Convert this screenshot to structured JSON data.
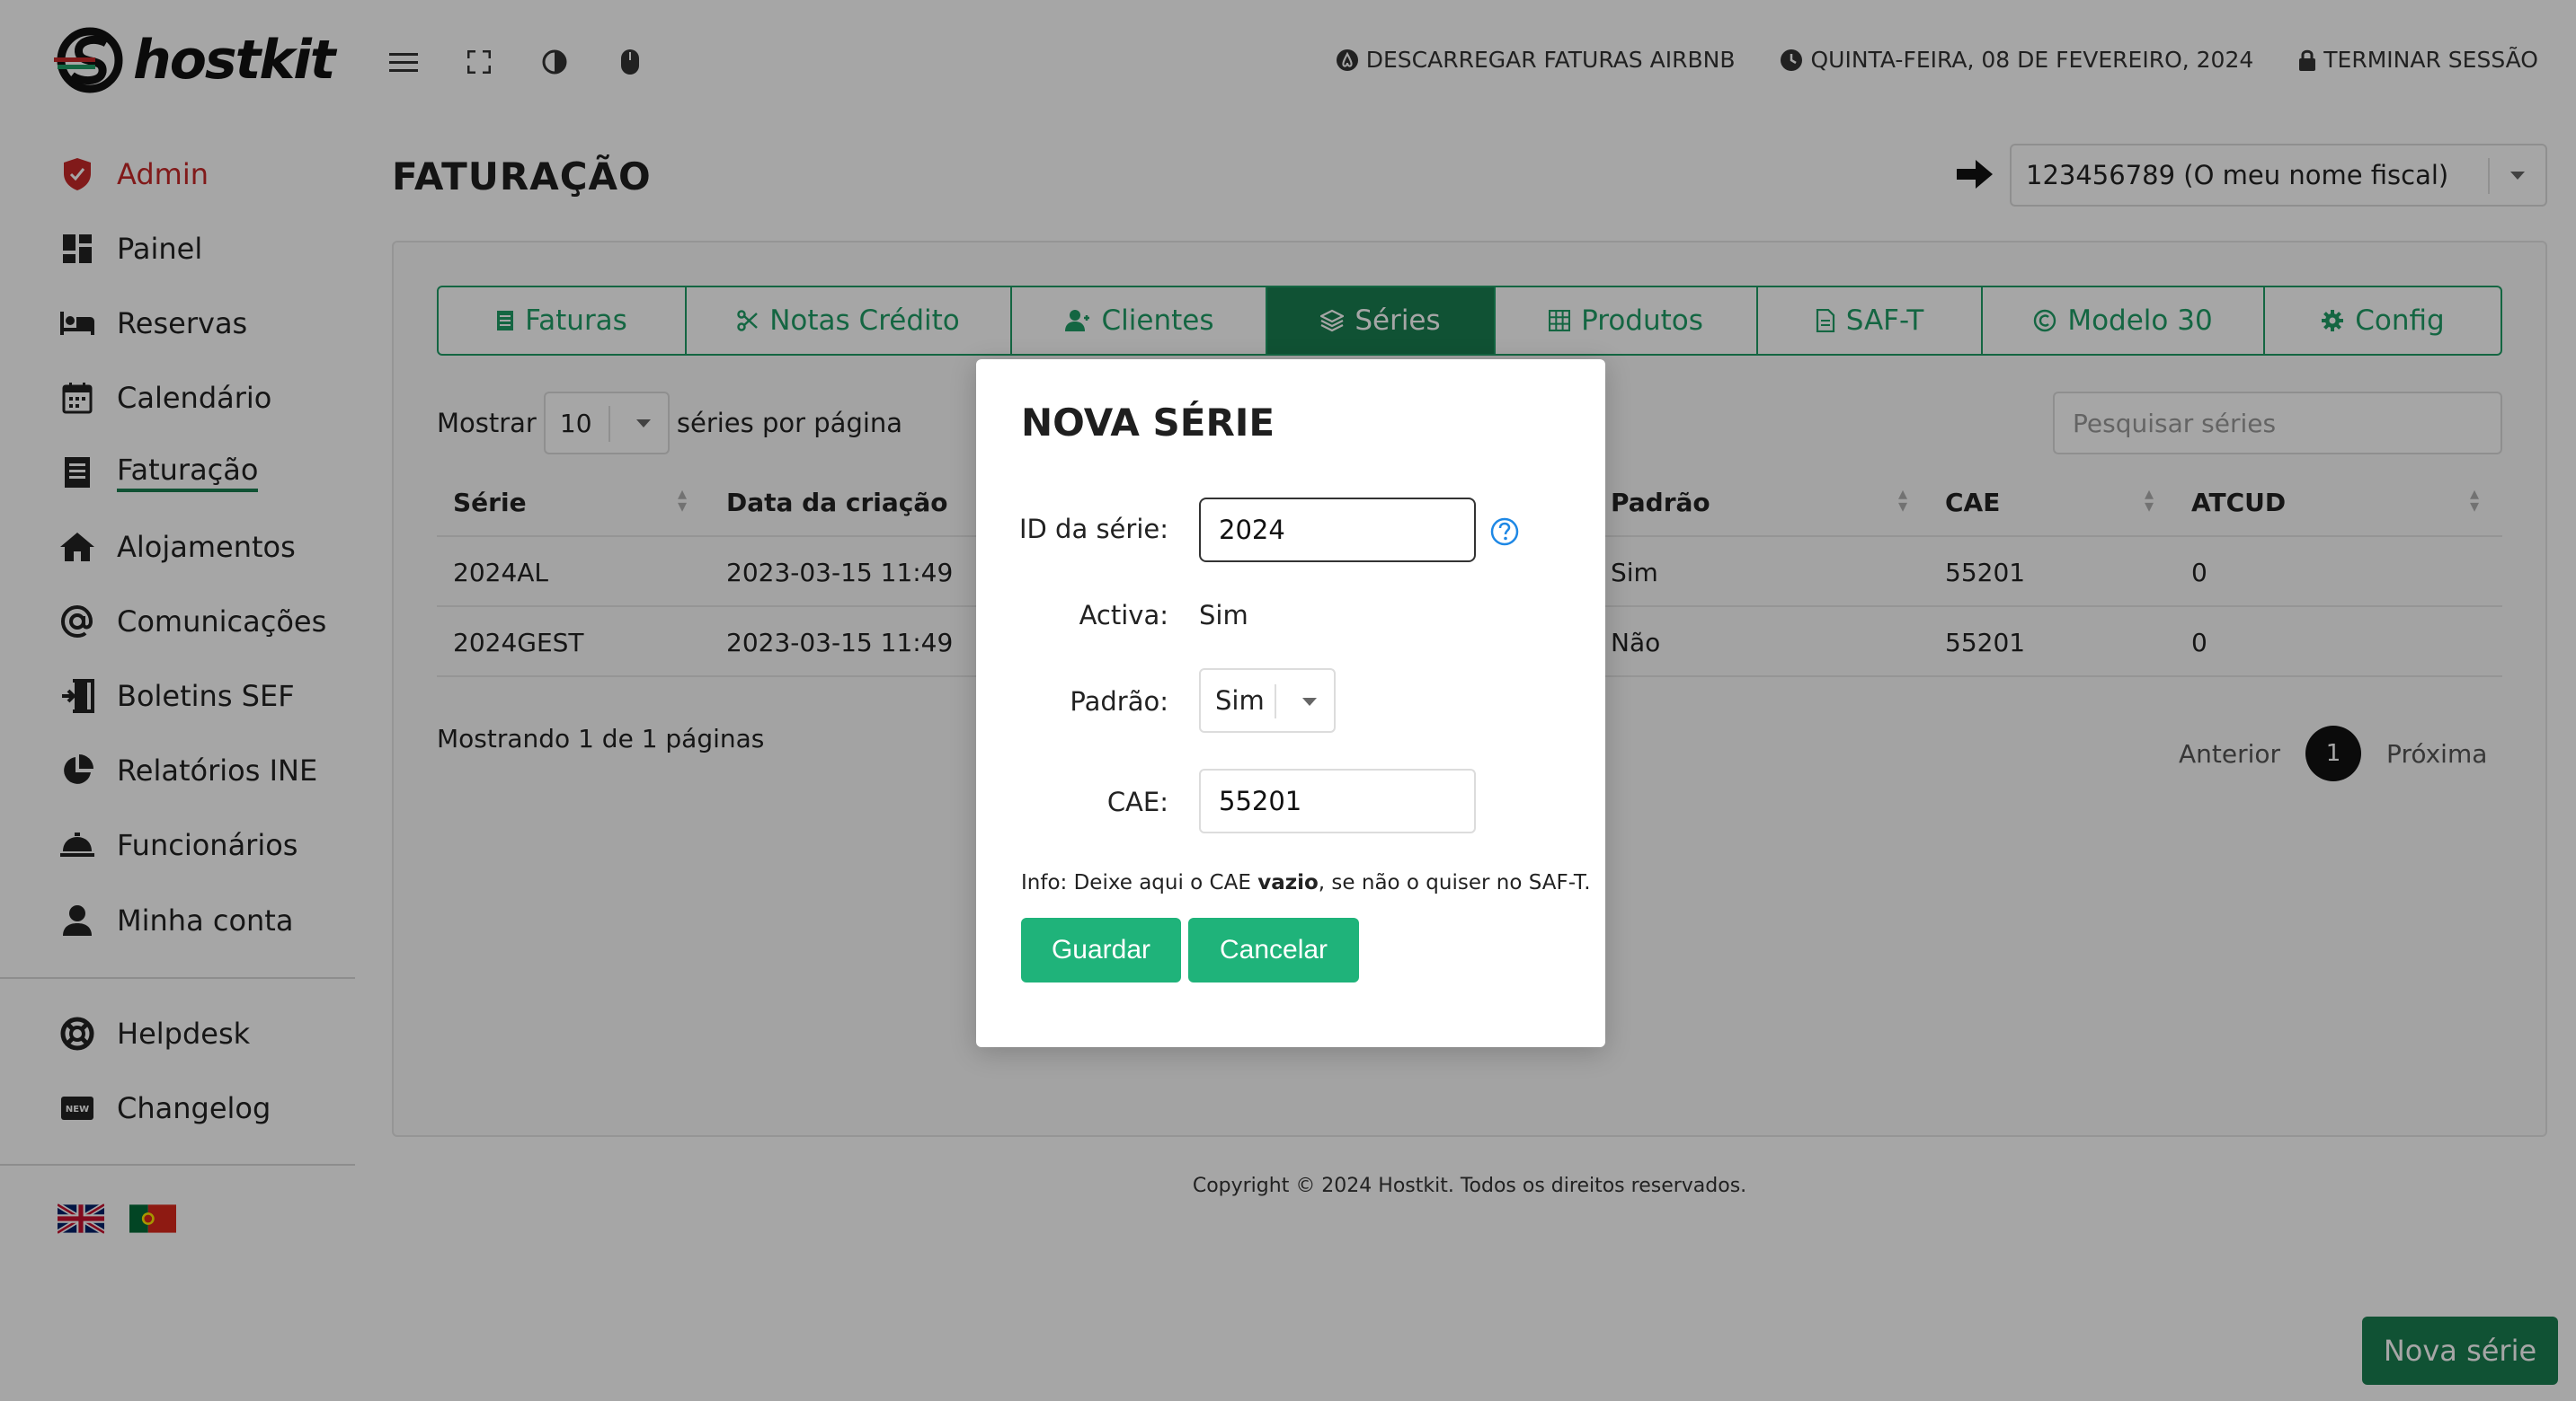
{
  "app": {
    "brand": "hostkit"
  },
  "header": {
    "download_airbnb": "DESCARREGAR FATURAS AIRBNB",
    "date": "QUINTA-FEIRA, 08 DE FEVEREIRO, 2024",
    "logout": "TERMINAR SESSÃO"
  },
  "sidebar": {
    "items": [
      {
        "label": "Admin",
        "icon": "shield-icon"
      },
      {
        "label": "Painel",
        "icon": "dashboard-icon"
      },
      {
        "label": "Reservas",
        "icon": "bed-icon"
      },
      {
        "label": "Calendário",
        "icon": "calendar-icon"
      },
      {
        "label": "Faturação",
        "icon": "receipt-icon"
      },
      {
        "label": "Alojamentos",
        "icon": "house-icon"
      },
      {
        "label": "Comunicações",
        "icon": "at-icon"
      },
      {
        "label": "Boletins SEF",
        "icon": "door-icon"
      },
      {
        "label": "Relatórios INE",
        "icon": "pie-chart-icon"
      },
      {
        "label": "Funcionários",
        "icon": "service-bell-icon"
      },
      {
        "label": "Minha conta",
        "icon": "user-icon"
      }
    ],
    "bottom": [
      {
        "label": "Helpdesk",
        "icon": "lifebuoy-icon"
      },
      {
        "label": "Changelog",
        "icon": "new-badge-icon"
      }
    ],
    "new_badge": "NEW"
  },
  "page": {
    "title": "FATURAÇÃO",
    "fiscal_selected": "123456789 (O meu nome fiscal)"
  },
  "tabs": [
    {
      "label": "Faturas",
      "icon": "document-icon"
    },
    {
      "label": "Notas Crédito",
      "icon": "scissors-icon"
    },
    {
      "label": "Clientes",
      "icon": "users-icon"
    },
    {
      "label": "Séries",
      "icon": "layers-icon"
    },
    {
      "label": "Produtos",
      "icon": "grid-icon"
    },
    {
      "label": "SAF-T",
      "icon": "file-icon"
    },
    {
      "label": "Modelo 30",
      "icon": "copyright-icon"
    },
    {
      "label": "Config",
      "icon": "gear-icon"
    }
  ],
  "list": {
    "show_label": "Mostrar",
    "per_page_value": "10",
    "per_page_suffix": "séries por página",
    "search_placeholder": "Pesquisar séries",
    "columns": [
      "Série",
      "Data da criação",
      "Padrão",
      "CAE",
      "ATCUD"
    ],
    "rows": [
      {
        "serie": "2024AL",
        "data": "2023-03-15 11:49",
        "padrao": "Sim",
        "cae": "55201",
        "atcud": "0"
      },
      {
        "serie": "2024GEST",
        "data": "2023-03-15 11:49",
        "padrao": "Não",
        "cae": "55201",
        "atcud": "0"
      }
    ],
    "showing": "Mostrando 1 de 1 páginas",
    "prev": "Anterior",
    "page": "1",
    "next": "Próxima"
  },
  "footer": {
    "copyright": "Copyright © 2024 Hostkit. Todos os direitos reservados."
  },
  "fab": {
    "label": "Nova série"
  },
  "modal": {
    "title": "NOVA SÉRIE",
    "id_label": "ID da série:",
    "id_value": "2024",
    "activa_label": "Activa:",
    "activa_value": "Sim",
    "padrao_label": "Padrão:",
    "padrao_value": "Sim",
    "cae_label": "CAE:",
    "cae_value": "55201",
    "info_prefix": "Info: Deixe aqui o CAE ",
    "info_bold": "vazio",
    "info_suffix": ", se não o quiser no SAF-T.",
    "save": "Guardar",
    "cancel": "Cancelar"
  },
  "colors": {
    "brand_green": "#1a7f50",
    "button_green": "#1fb37a",
    "admin_red": "#c62828",
    "help_blue": "#1e88e5"
  }
}
